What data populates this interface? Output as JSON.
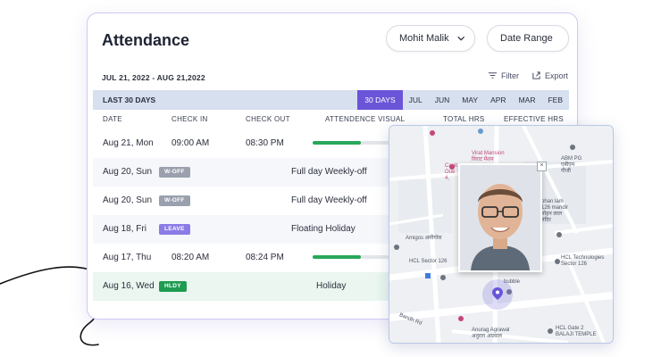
{
  "page": {
    "title": "Attendance"
  },
  "filters": {
    "user": "Mohit Malik",
    "range_button": "Date Range",
    "date_range": "JUL 21, 2022 - AUG 21,2022",
    "filter_label": "Filter",
    "export_label": "Export"
  },
  "period": {
    "label": "LAST 30 DAYS",
    "tabs": [
      "30 DAYS",
      "JUL",
      "JUN",
      "MAY",
      "APR",
      "MAR",
      "FEB"
    ],
    "active": "30 DAYS"
  },
  "table": {
    "columns": [
      "DATE",
      "CHECK IN",
      "CHECK OUT",
      "ATTENDENCE VISUAL",
      "TOTAL HRS",
      "EFFECTIVE HRS"
    ],
    "rows": [
      {
        "date": "Aug 21, Mon",
        "badge": "",
        "check_in": "09:00 AM",
        "check_out": "08:30 PM",
        "note": "",
        "visual": 0.56
      },
      {
        "date": "Aug 20, Sun",
        "badge": "W-OFF",
        "check_in": "",
        "check_out": "",
        "note": "Full day Weekly-off",
        "visual": null
      },
      {
        "date": "Aug 20, Sun",
        "badge": "W-OFF",
        "check_in": "",
        "check_out": "",
        "note": "Full day Weekly-off",
        "visual": null
      },
      {
        "date": "Aug 18, Fri",
        "badge": "LEAVE",
        "check_in": "",
        "check_out": "",
        "note": "Floating Holiday",
        "visual": null
      },
      {
        "date": "Aug 17, Thu",
        "badge": "",
        "check_in": "08:20 AM",
        "check_out": "08:24 PM",
        "note": "",
        "visual": 0.56
      },
      {
        "date": "Aug 16, Wed",
        "badge": "HLDY",
        "check_in": "",
        "check_out": "",
        "note": "Holiday",
        "visual": null
      }
    ]
  },
  "map": {
    "labels": {
      "virat": "Virat Mansion\nविराट मेंशन",
      "capital": "Capit\nOue\n4,",
      "abm": "ABM PG\nएबीएम\nपीजी",
      "mohan": "ohan lam\n126 mandir\nमोहन लाल\nमंदिर",
      "amigos": "Amigos अमीगोस",
      "hcl_sector": "HCL Sector 126",
      "hcl_tech": "HCL Technologies\nSector 126",
      "bubble": "bubble",
      "bandh": "Bandh Rd",
      "anurag": "Anurag Agrawal\nअनुराग अग्रवाल",
      "hcl_gate": "HCL Gate 2\nBALAJI TEMPLE"
    },
    "colors": {
      "road": "#ffffff",
      "land": "#eef0f3",
      "pin": "#6a55d8"
    }
  },
  "colors": {
    "accent": "#6a55d8",
    "present": "#27a85a",
    "woff": "#9aa0ad",
    "leave": "#8b7be6",
    "holiday": "#1f9b52"
  }
}
